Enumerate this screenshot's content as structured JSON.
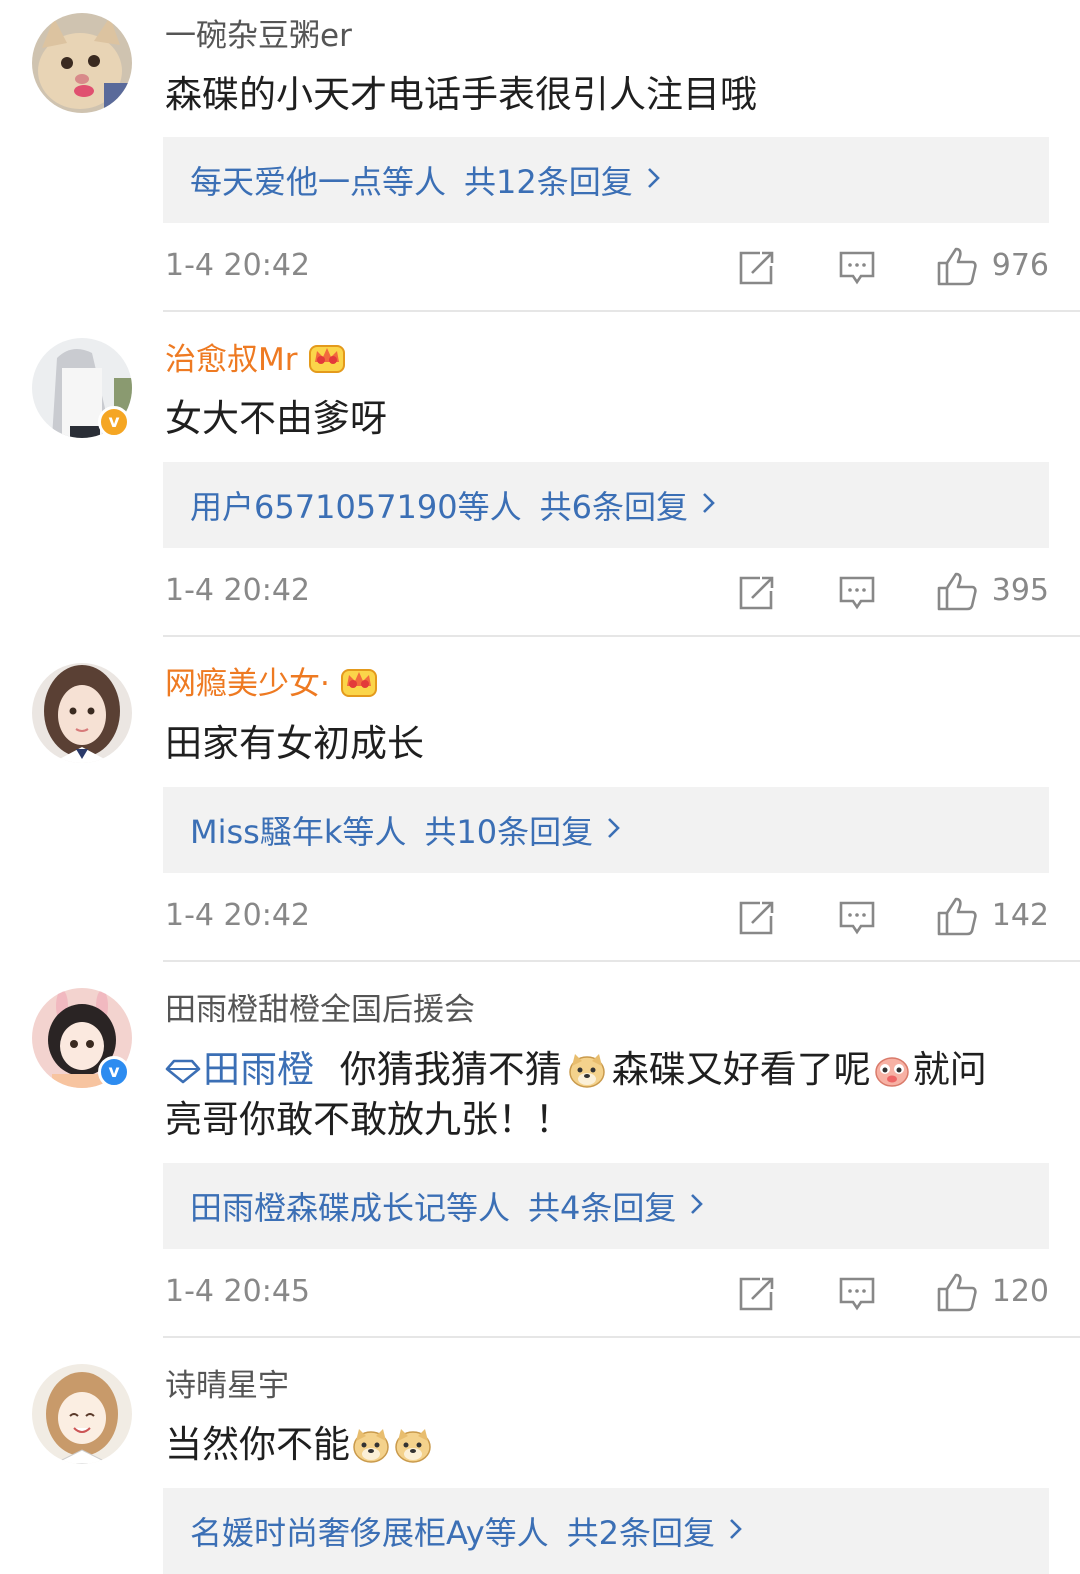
{
  "comments": [
    {
      "username": "一碗杂豆粥er",
      "text": "森碟的小天才电话手表很引人注目哦",
      "reply_names": "每天爱他一点等人",
      "reply_count": "共12条回复",
      "time": "1-4 20:42",
      "likes": "976"
    },
    {
      "username": "治愈叔Mr",
      "text": "女大不由爹呀",
      "reply_names": "用户6571057190等人",
      "reply_count": "共6条回复",
      "time": "1-4 20:42",
      "likes": "395"
    },
    {
      "username": "网瘾美少女·",
      "text": "田家有女初成长",
      "reply_names": "Miss騷年k等人",
      "reply_count": "共10条回复",
      "time": "1-4 20:42",
      "likes": "142"
    },
    {
      "username": "田雨橙甜橙全国后援会",
      "mention": "田雨橙",
      "text_a": "你猜我猜不猜",
      "text_b": "森碟又好看了呢",
      "text_c": "就问",
      "text_line2": "亮哥你敢不敢放九张！！",
      "reply_names": "田雨橙森碟成长记等人",
      "reply_count": "共4条回复",
      "time": "1-4 20:45",
      "likes": "120"
    },
    {
      "username": "诗晴星宇",
      "text": "当然你不能",
      "reply_names": "名媛时尚奢侈展柜Ay等人",
      "reply_count": "共2条回复"
    }
  ],
  "colors": {
    "vip_name": "#ee7a22",
    "link": "#3b6fb5",
    "reply_bg": "#f2f2f2",
    "meta_text": "#888888"
  },
  "icons": [
    "share-icon",
    "comment-icon",
    "like-icon",
    "crown-badge-icon",
    "verified-badge-icon",
    "doge-emoji-icon",
    "pig-emoji-icon",
    "superchat-diamond-icon"
  ]
}
